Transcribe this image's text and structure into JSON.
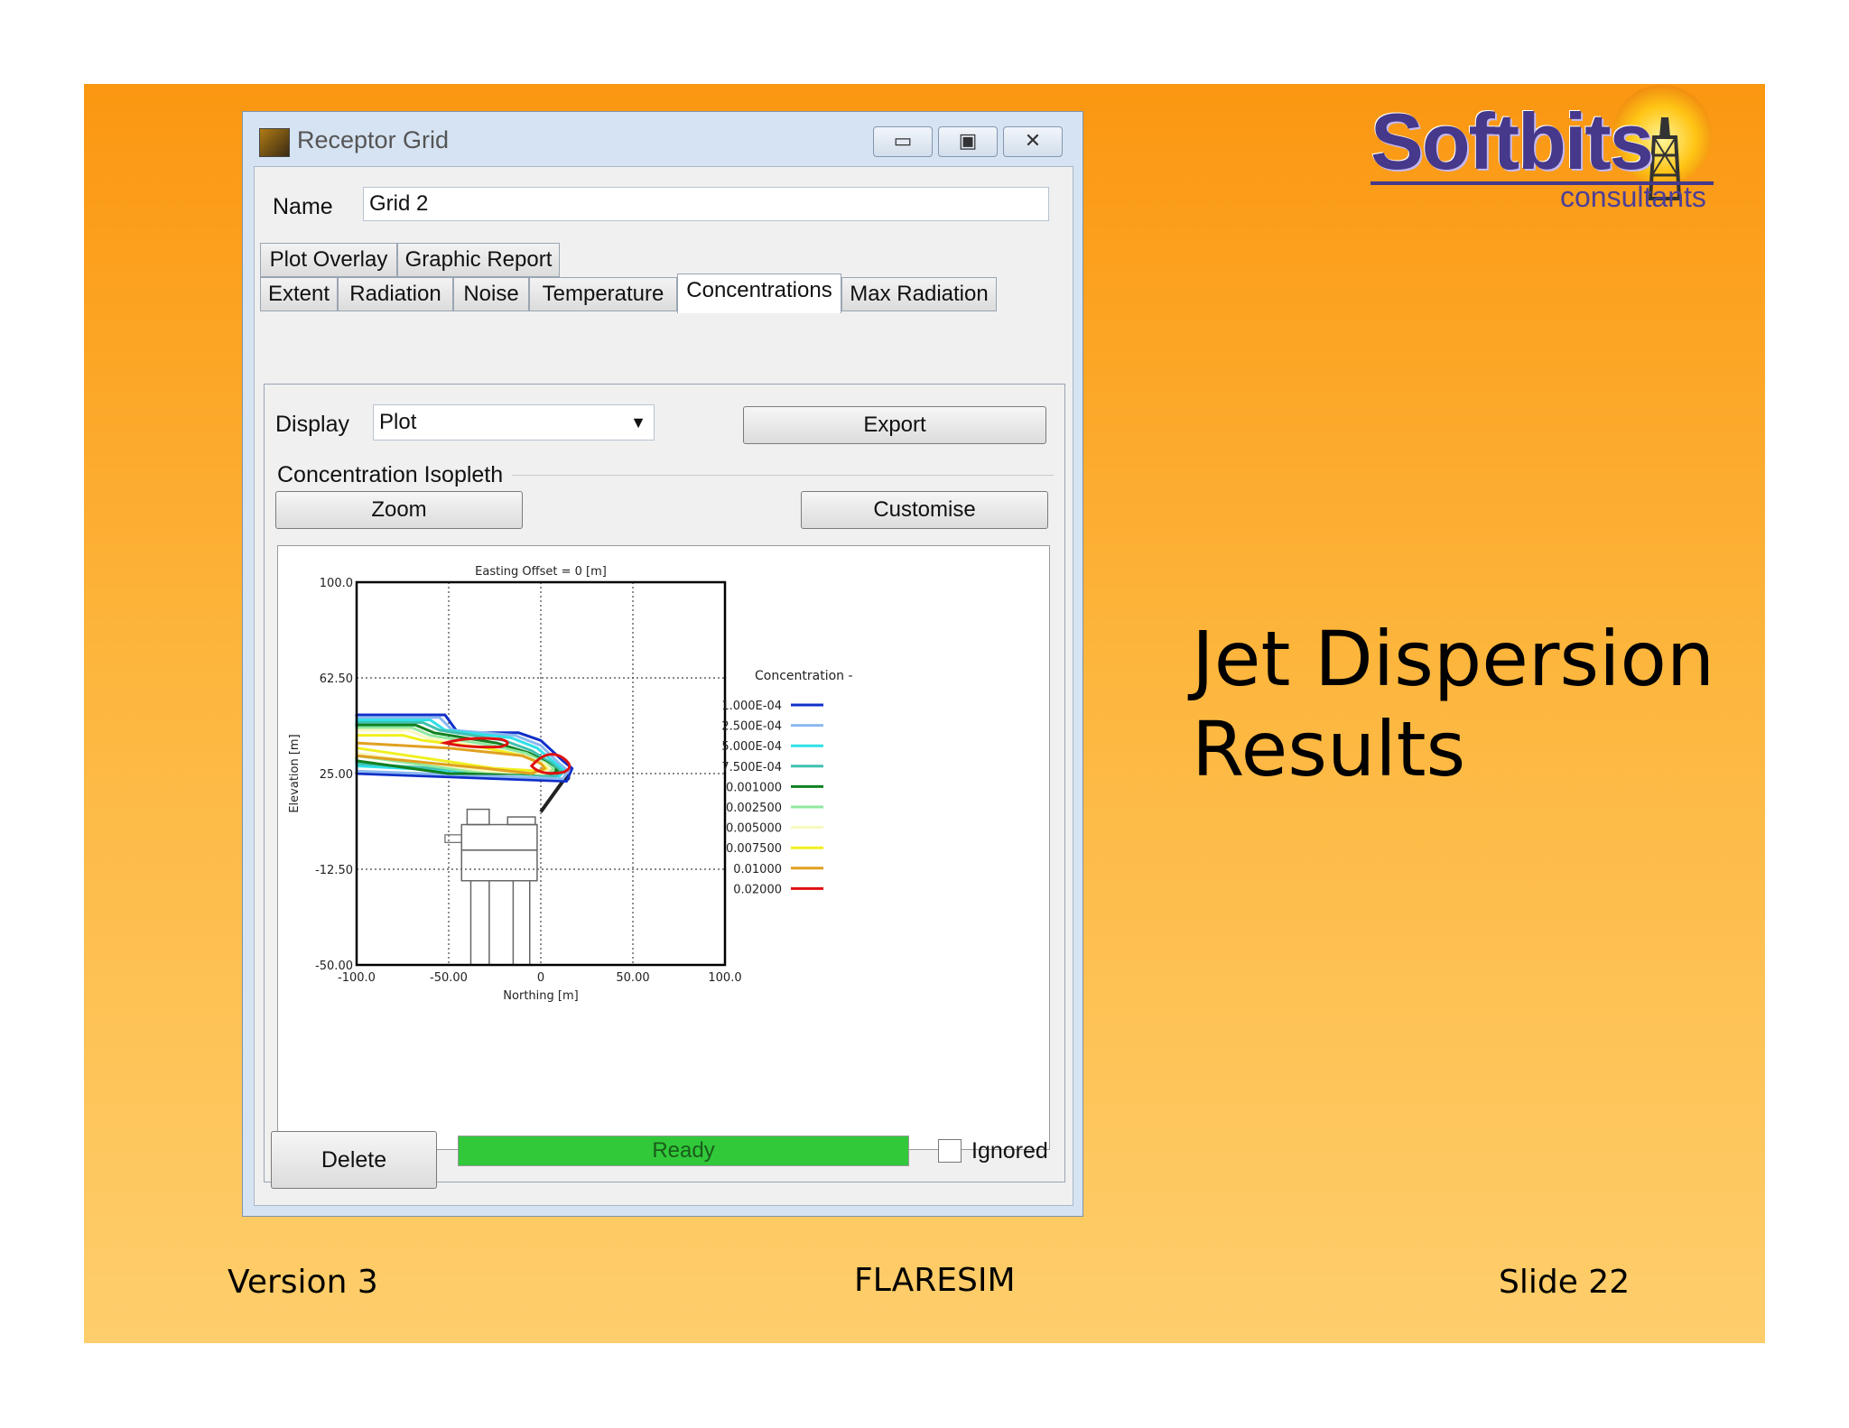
{
  "slide": {
    "title_line1": "Jet Dispersion",
    "title_line2": "Results",
    "footer_left": "Version 3",
    "footer_center": "FLARESIM",
    "footer_right": "Slide 22",
    "logo_main": "Softbits",
    "logo_sub": "consultants"
  },
  "window": {
    "title": "Receptor Grid",
    "name_label": "Name",
    "name_value": "Grid 2",
    "tabs_row1": [
      "Plot Overlay",
      "Graphic Report"
    ],
    "tabs_row2": [
      "Extent",
      "Radiation",
      "Noise",
      "Temperature",
      "Concentrations",
      "Max Radiation"
    ],
    "active_tab": "Concentrations",
    "display_label": "Display",
    "display_value": "Plot",
    "export_label": "Export",
    "group_label": "Concentration Isopleth",
    "zoom_label": "Zoom",
    "customise_label": "Customise",
    "delete_label": "Delete",
    "status_text": "Ready",
    "progress": 1.0,
    "ignored_label": "Ignored",
    "ignored_checked": false
  },
  "chart_data": {
    "type": "line",
    "title": "Easting Offset = 0 [m]",
    "xlabel": "Northing [m]",
    "ylabel": "Elevation [m]",
    "xlim": [
      -100,
      100
    ],
    "ylim": [
      -50,
      100
    ],
    "x_ticks": [
      "-100.0",
      "-50.00",
      "0",
      "50.00",
      "100.0"
    ],
    "y_ticks": [
      "100.0",
      "62.50",
      "25.00",
      "-12.50",
      "-50.00"
    ],
    "grid": true,
    "legend_title": "Concentration -",
    "legend_position": "right",
    "series": [
      {
        "name": "1.000E-04",
        "color": "#1030c8"
      },
      {
        "name": "2.500E-04",
        "color": "#8cb8f0"
      },
      {
        "name": "5.000E-04",
        "color": "#30e0e8"
      },
      {
        "name": "7.500E-04",
        "color": "#40c0b0"
      },
      {
        "name": "0.001000",
        "color": "#108020"
      },
      {
        "name": "0.002500",
        "color": "#90e8a0"
      },
      {
        "name": "0.005000",
        "color": "#f8f8c0"
      },
      {
        "name": "0.007500",
        "color": "#f0f020"
      },
      {
        "name": "0.01000",
        "color": "#e0a020"
      },
      {
        "name": "0.02000",
        "color": "#e01010"
      }
    ]
  }
}
